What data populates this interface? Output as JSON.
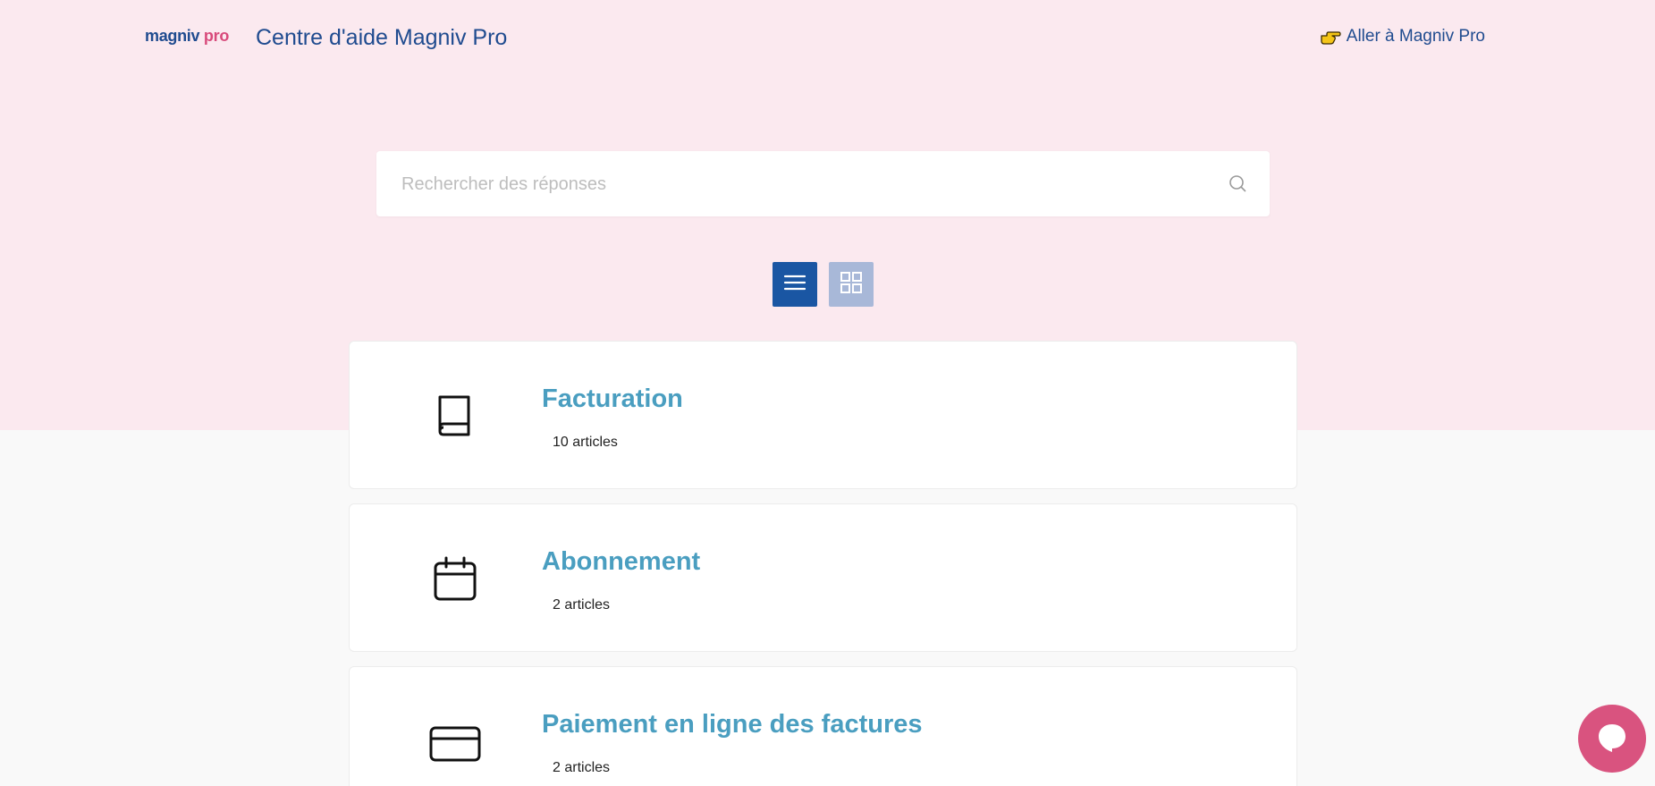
{
  "header": {
    "logo_main": "magniv",
    "logo_accent": "pro",
    "site_title": "Centre d'aide Magniv Pro",
    "goto_link": "Aller à Magniv Pro"
  },
  "search": {
    "placeholder": "Rechercher des réponses",
    "value": ""
  },
  "view_toggle": {
    "active": "list",
    "options": [
      "list",
      "grid"
    ]
  },
  "categories": [
    {
      "title": "Facturation",
      "count": "10 articles",
      "icon": "book-icon"
    },
    {
      "title": "Abonnement",
      "count": "2 articles",
      "icon": "calendar-icon"
    },
    {
      "title": "Paiement en ligne des factures",
      "count": "2 articles",
      "icon": "credit-card-icon"
    }
  ],
  "colors": {
    "hero_bg": "#fbe9ef",
    "page_bg": "#f9f9f9",
    "brand_blue": "#1f4b8f",
    "category_title": "#4a9ec0",
    "toggle_active": "#1a56a3",
    "toggle_inactive": "#a8b8d8",
    "chat_button": "#d9537f"
  },
  "chat": {
    "icon": "chat-bubble-icon"
  }
}
